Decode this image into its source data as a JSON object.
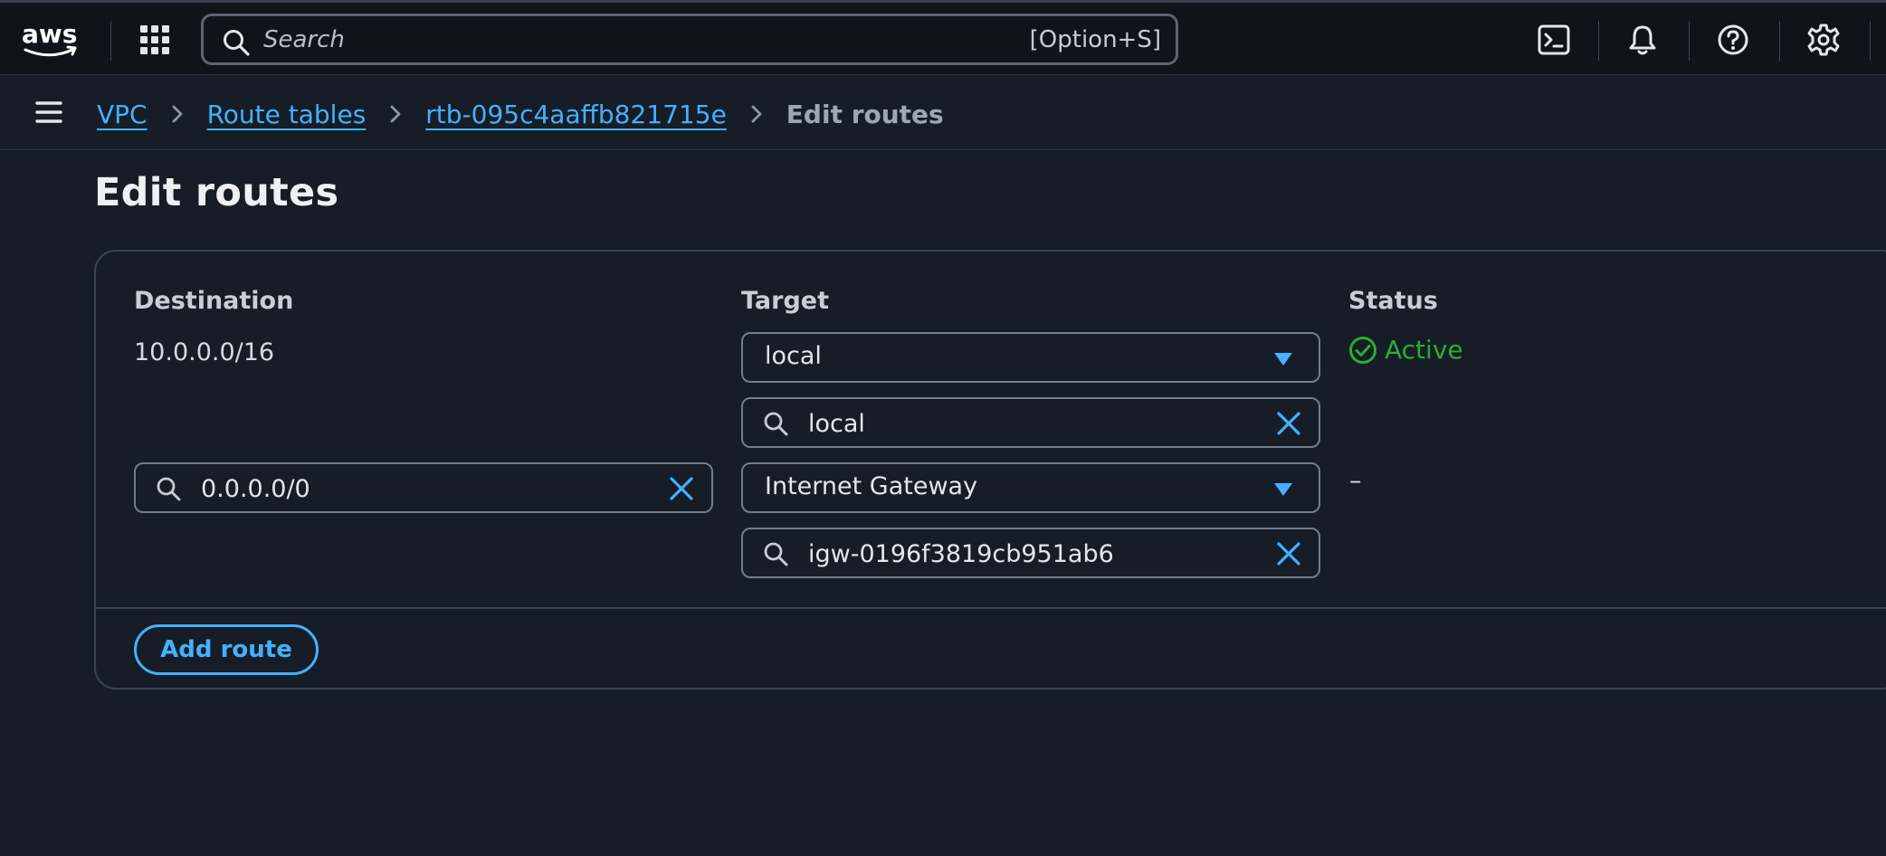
{
  "header": {
    "logo_text": "aws",
    "search": {
      "placeholder": "Search",
      "shortcut": "[Option+S]"
    },
    "icons": [
      "cloudshell-icon",
      "notifications-icon",
      "help-icon",
      "settings-icon"
    ]
  },
  "breadcrumb": {
    "items": [
      "VPC",
      "Route tables",
      "rtb-095c4aaffb821715e"
    ],
    "current": "Edit routes"
  },
  "page": {
    "title": "Edit routes"
  },
  "routes_table": {
    "columns": {
      "destination": "Destination",
      "target": "Target",
      "status": "Status"
    },
    "rows": [
      {
        "destination": "10.0.0.0/16",
        "target_type": "local",
        "target_value": "local",
        "status": "Active"
      },
      {
        "destination": "0.0.0.0/0",
        "target_type": "Internet Gateway",
        "target_value": "igw-0196f3819cb951ab6",
        "status": "–"
      }
    ],
    "add_route_label": "Add route"
  },
  "colors": {
    "link": "#44b0ff",
    "success": "#29ad32",
    "background": "#161d26",
    "topbar": "#0f141a"
  }
}
